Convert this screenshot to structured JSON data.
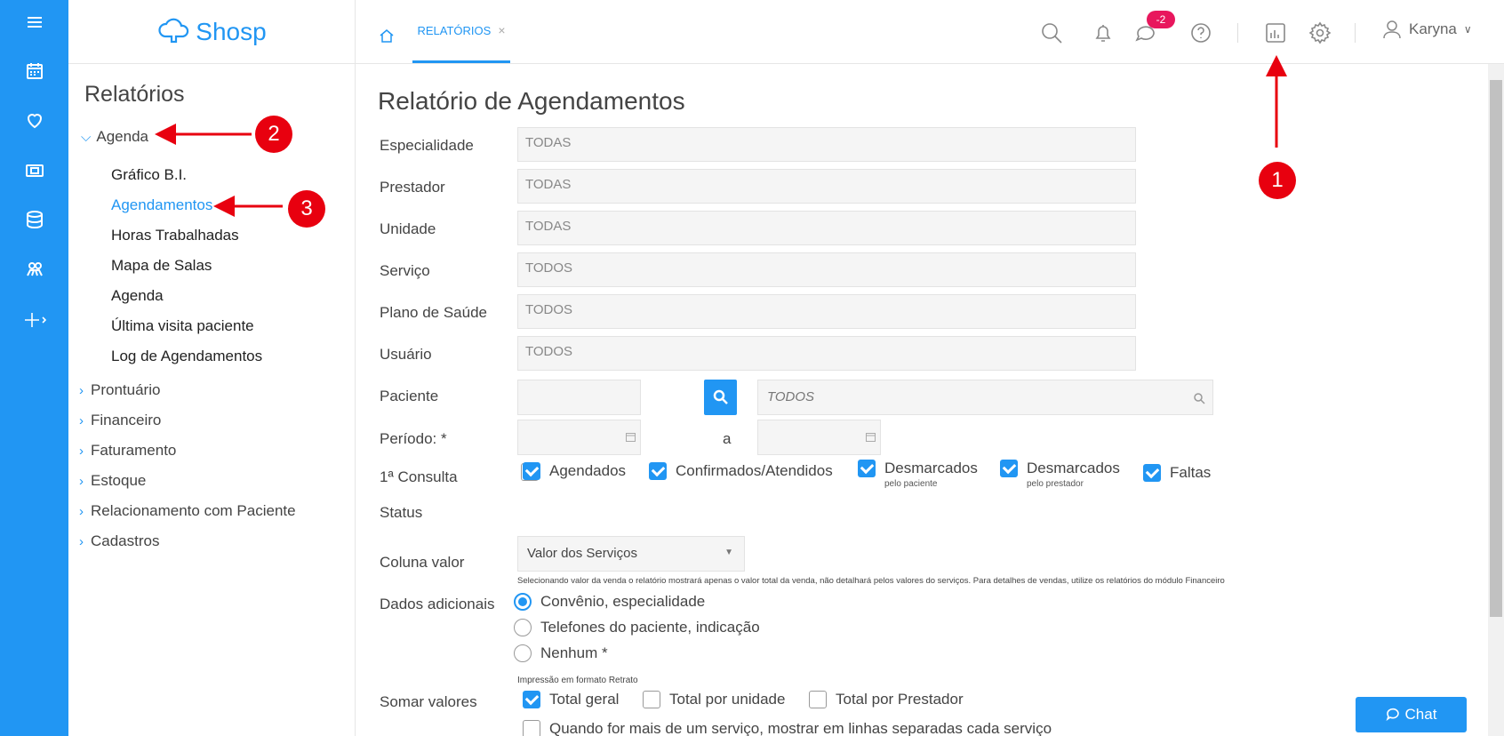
{
  "app": {
    "name": "Shosp"
  },
  "left_nav": {
    "title": "Relatórios",
    "open_section": "Agenda",
    "sub_items": [
      "Gráfico B.I.",
      "Agendamentos",
      "Horas Trabalhadas",
      "Mapa de Salas",
      "Agenda",
      "Última visita paciente",
      "Log de Agendamentos"
    ],
    "active_sub": "Agendamentos",
    "sections": [
      "Prontuário",
      "Financeiro",
      "Faturamento",
      "Estoque",
      "Relacionamento com Paciente",
      "Cadastros"
    ]
  },
  "topbar": {
    "tab_label": "RELATÓRIOS",
    "tab_close": "×",
    "notification_count": "-2",
    "user_name": "Karyna"
  },
  "form": {
    "title": "Relatório de Agendamentos",
    "fields": [
      {
        "label": "Especialidade",
        "value": "TODAS"
      },
      {
        "label": "Prestador",
        "value": "TODAS"
      },
      {
        "label": "Unidade",
        "value": "TODAS"
      },
      {
        "label": "Serviço",
        "value": "TODOS"
      },
      {
        "label": "Plano de Saúde",
        "value": "TODOS"
      },
      {
        "label": "Usuário",
        "value": "TODOS"
      }
    ],
    "paciente_label": "Paciente",
    "paciente_placeholder": "TODOS",
    "periodo_label": "Período: *",
    "periodo_sep": "a",
    "primeira_consulta_label": "1ª Consulta",
    "status_label": "Status",
    "status_options": [
      {
        "label": "Agendados",
        "sub": "",
        "checked": true
      },
      {
        "label": "Confirmados/Atendidos",
        "sub": "",
        "checked": true
      },
      {
        "label": "Desmarcados",
        "sub": "pelo paciente",
        "checked": true
      },
      {
        "label": "Desmarcados",
        "sub": "pelo prestador",
        "checked": true
      },
      {
        "label": "Faltas",
        "sub": "",
        "checked": true
      }
    ],
    "coluna_valor_label": "Coluna valor",
    "coluna_valor_selected": "Valor dos Serviços",
    "coluna_valor_note": "Selecionando valor da venda o relatório mostrará apenas o valor total da venda, não detalhará pelos valores do serviços. Para detalhes de vendas, utilize os relatórios do módulo Financeiro",
    "dados_label": "Dados adicionais",
    "dados_options": [
      "Convênio, especialidade",
      "Telefones do paciente, indicação",
      "Nenhum *"
    ],
    "dados_selected": 0,
    "impressao_note": "Impressão em formato Retrato",
    "somar_label": "Somar valores",
    "somar_options": [
      {
        "label": "Total geral",
        "checked": true
      },
      {
        "label": "Total por unidade",
        "checked": false
      },
      {
        "label": "Total por Prestador",
        "checked": false
      }
    ],
    "partial_option": "Quando for mais de um serviço, mostrar em linhas separadas cada serviço"
  },
  "chat_label": "Chat",
  "annotations": [
    "1",
    "2",
    "3"
  ],
  "colors": {
    "primary": "#2196f3",
    "badge": "#e8175d",
    "annotation": "#e8000f"
  }
}
